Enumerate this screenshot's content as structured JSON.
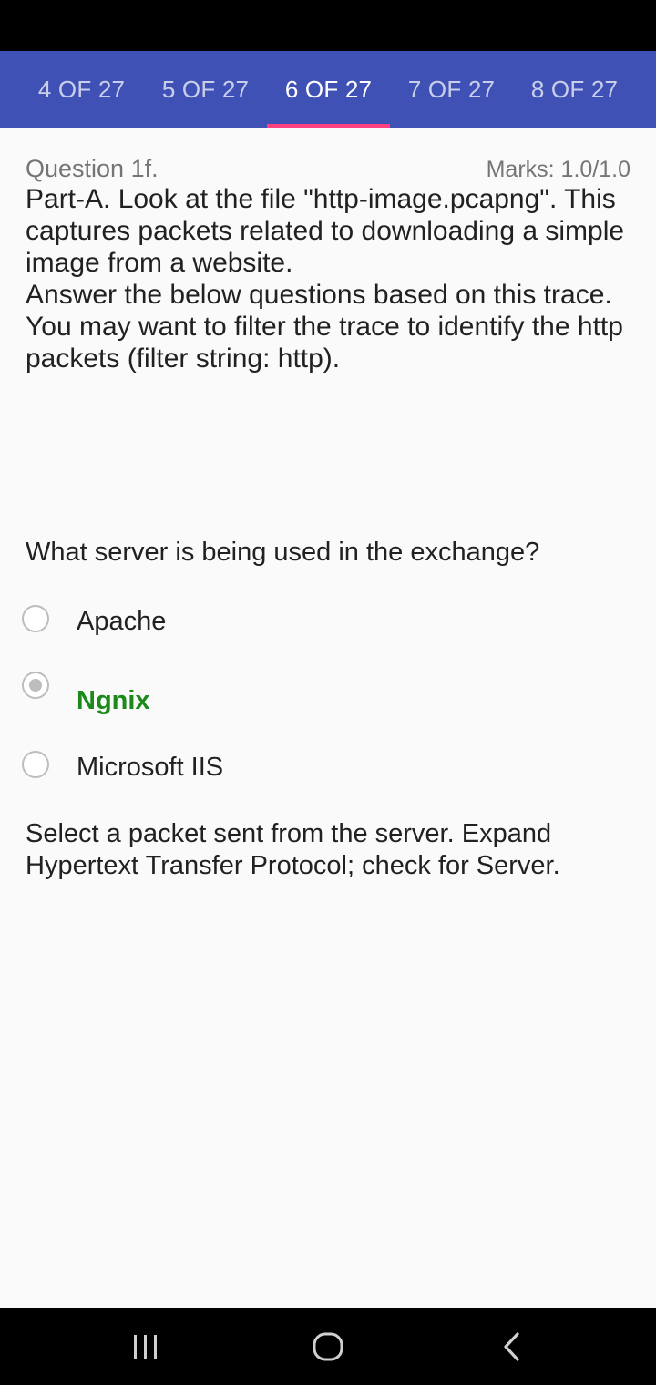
{
  "tabs": [
    {
      "label": "4 OF 27"
    },
    {
      "label": "5 OF 27"
    },
    {
      "label": "6 OF 27",
      "active": true
    },
    {
      "label": "7 OF 27"
    },
    {
      "label": "8 OF 27"
    }
  ],
  "question": {
    "number": "Question 1f.",
    "marks": "Marks: 1.0/1.0",
    "paragraphs": [
      "Part-A. Look at the file \"http-image.pcapng\". This captures packets related to downloading a simple image from a website.",
      "Answer the below questions based on this trace. You may want to filter the trace to identify the http packets (filter string: http)."
    ],
    "prompt": "What server is being used in the exchange?",
    "options": [
      {
        "label": "Apache",
        "selected": false
      },
      {
        "label": "Ngnix",
        "selected": true,
        "correct": true
      },
      {
        "label": "Microsoft IIS",
        "selected": false
      }
    ],
    "feedback": "Select a packet sent from the server. Expand Hypertext Transfer Protocol; check for Server."
  },
  "colors": {
    "tab_bar": "#3f51b5",
    "tab_indicator": "#ff4081",
    "correct_answer": "#1b8a1b"
  },
  "nav_icons": [
    "recent-apps-icon",
    "home-icon",
    "back-icon"
  ]
}
